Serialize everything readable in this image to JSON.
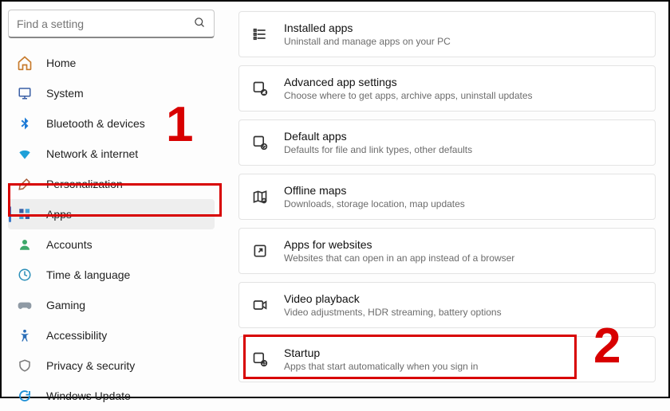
{
  "search": {
    "placeholder": "Find a setting"
  },
  "sidebar": {
    "items": [
      {
        "label": "Home"
      },
      {
        "label": "System"
      },
      {
        "label": "Bluetooth & devices"
      },
      {
        "label": "Network & internet"
      },
      {
        "label": "Personalization"
      },
      {
        "label": "Apps"
      },
      {
        "label": "Accounts"
      },
      {
        "label": "Time & language"
      },
      {
        "label": "Gaming"
      },
      {
        "label": "Accessibility"
      },
      {
        "label": "Privacy & security"
      },
      {
        "label": "Windows Update"
      }
    ]
  },
  "cards": [
    {
      "title": "Installed apps",
      "desc": "Uninstall and manage apps on your PC"
    },
    {
      "title": "Advanced app settings",
      "desc": "Choose where to get apps, archive apps, uninstall updates"
    },
    {
      "title": "Default apps",
      "desc": "Defaults for file and link types, other defaults"
    },
    {
      "title": "Offline maps",
      "desc": "Downloads, storage location, map updates"
    },
    {
      "title": "Apps for websites",
      "desc": "Websites that can open in an app instead of a browser"
    },
    {
      "title": "Video playback",
      "desc": "Video adjustments, HDR streaming, battery options"
    },
    {
      "title": "Startup",
      "desc": "Apps that start automatically when you sign in"
    }
  ],
  "annotations": {
    "num1": "1",
    "num2": "2"
  },
  "colors": {
    "annotation_red": "#d80000",
    "nav_accent": "#3a77c8"
  }
}
